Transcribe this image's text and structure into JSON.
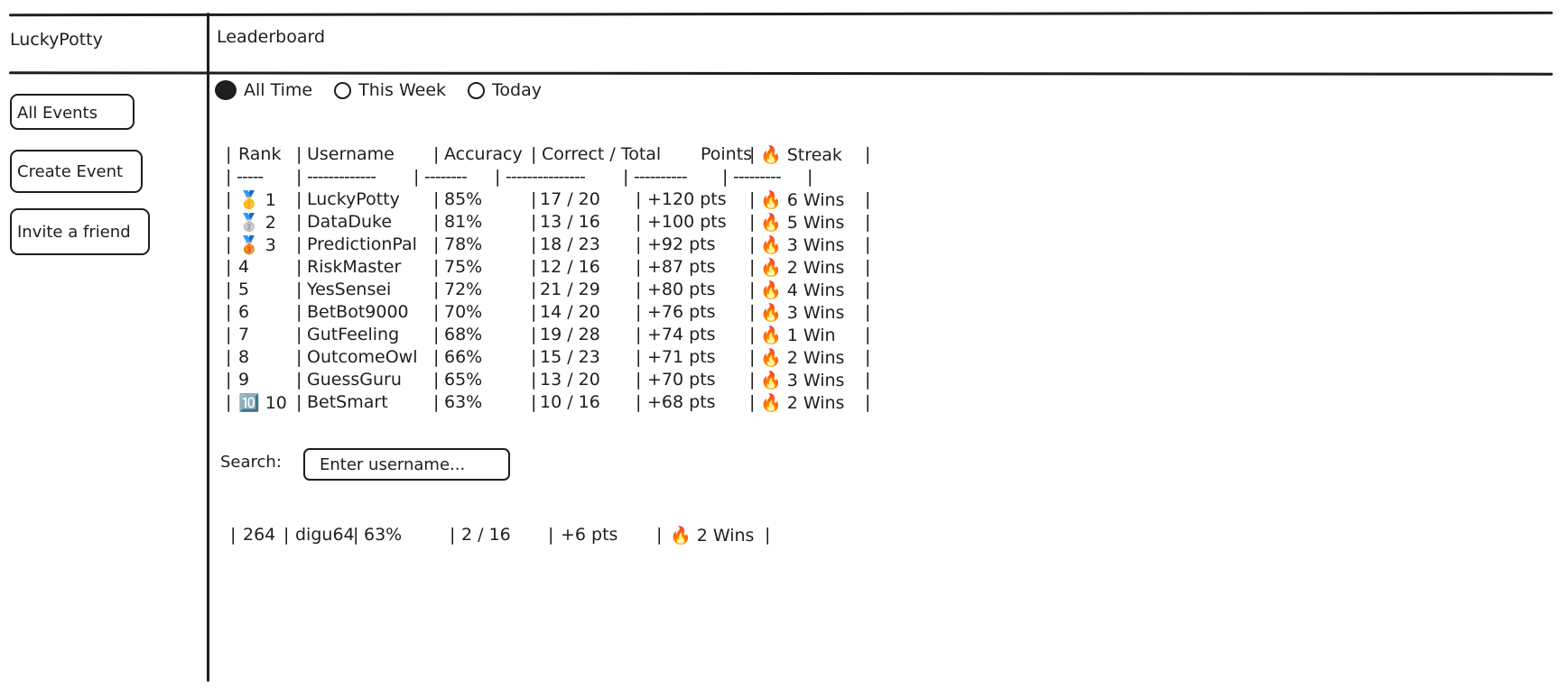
{
  "app": {
    "brand": "LuckyPotty",
    "page_title": "Leaderboard"
  },
  "sidebar": {
    "items": [
      {
        "label": "All Events"
      },
      {
        "label": "Create Event"
      },
      {
        "label": "Invite a friend"
      }
    ]
  },
  "filters": {
    "options": [
      {
        "label": "All Time",
        "selected": true
      },
      {
        "label": "This Week",
        "selected": false
      },
      {
        "label": "Today",
        "selected": false
      }
    ]
  },
  "table": {
    "headers": {
      "rank": "Rank",
      "username": "Username",
      "accuracy": "Accuracy",
      "correct_total": "Correct / Total",
      "points": "Points",
      "streak": "🔥 Streak"
    },
    "separators": {
      "rank": "-----",
      "username": "-------------",
      "accuracy": "--------",
      "correct_total": "---------------",
      "points": "----------",
      "streak": "---------"
    },
    "rows": [
      {
        "rank": "🥇 1",
        "username": "LuckyPotty",
        "accuracy": "85%",
        "correct_total": "17 / 20",
        "points": "+120 pts",
        "streak": "🔥 6 Wins"
      },
      {
        "rank": "🥈 2",
        "username": "DataDuke",
        "accuracy": "81%",
        "correct_total": "13 / 16",
        "points": "+100 pts",
        "streak": "🔥 5 Wins"
      },
      {
        "rank": "🥉 3",
        "username": "PredictionPal",
        "accuracy": "78%",
        "correct_total": "18 / 23",
        "points": "+92 pts",
        "streak": "🔥 3 Wins"
      },
      {
        "rank": "4",
        "username": "RiskMaster",
        "accuracy": "75%",
        "correct_total": "12 / 16",
        "points": "+87 pts",
        "streak": "🔥 2 Wins"
      },
      {
        "rank": "5",
        "username": "YesSensei",
        "accuracy": "72%",
        "correct_total": "21 / 29",
        "points": "+80 pts",
        "streak": "🔥 4 Wins"
      },
      {
        "rank": "6",
        "username": "BetBot9000",
        "accuracy": "70%",
        "correct_total": "14 / 20",
        "points": "+76 pts",
        "streak": "🔥 3 Wins"
      },
      {
        "rank": "7",
        "username": "GutFeeling",
        "accuracy": "68%",
        "correct_total": "19 / 28",
        "points": "+74 pts",
        "streak": "🔥 1 Win"
      },
      {
        "rank": "8",
        "username": "OutcomeOwl",
        "accuracy": "66%",
        "correct_total": "15 / 23",
        "points": "+71 pts",
        "streak": "🔥 2 Wins"
      },
      {
        "rank": "9",
        "username": "GuessGuru",
        "accuracy": "65%",
        "correct_total": "13 / 20",
        "points": "+70 pts",
        "streak": "🔥 3 Wins"
      },
      {
        "rank": "🔟 10",
        "username": "BetSmart",
        "accuracy": "63%",
        "correct_total": "10 / 16",
        "points": "+68 pts",
        "streak": "🔥 2 Wins"
      }
    ]
  },
  "search": {
    "label": "Search:",
    "placeholder": "Enter username..."
  },
  "user_row": {
    "rank": "264",
    "username": "digu64",
    "accuracy": "63%",
    "correct_total": "2 / 16",
    "points": "+6 pts",
    "streak": "🔥 2 Wins"
  }
}
